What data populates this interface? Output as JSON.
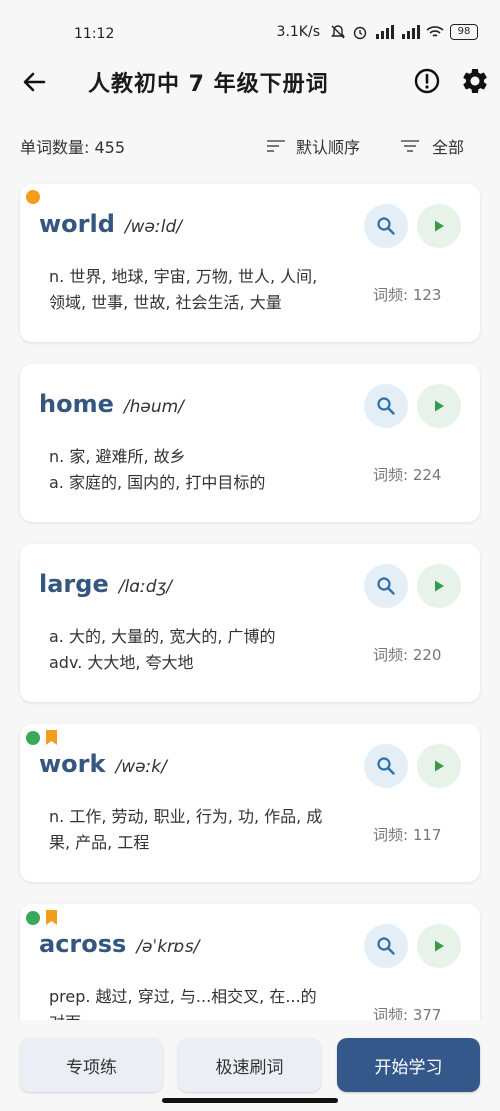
{
  "status_bar": {
    "time": "11:12",
    "network_speed": "3.1K/s",
    "battery": "98"
  },
  "header": {
    "title": "人教初中 7 年级下册词"
  },
  "filter": {
    "count_label": "单词数量: 455",
    "sort_label": "默认顺序",
    "scope_label": "全部"
  },
  "words": [
    {
      "word": "world",
      "phonetic": "/wəːld/",
      "meaning_lines": [
        "n. 世界, 地球, 宇宙, 万物, 世人, 人间,",
        "领域, 世事, 世故, 社会生活, 大量"
      ],
      "freq": "词频: 123",
      "dot_color": "#f39c1e",
      "bookmarked": false
    },
    {
      "word": "home",
      "phonetic": "/həum/",
      "meaning_lines": [
        "n. 家, 避难所, 故乡",
        "a. 家庭的, 国内的, 打中目标的"
      ],
      "freq": "词频: 224",
      "dot_color": "",
      "bookmarked": false
    },
    {
      "word": "large",
      "phonetic": "/lɑːdʒ/",
      "meaning_lines": [
        "a. 大的, 大量的, 宽大的, 广博的",
        "adv. 大大地, 夸大地"
      ],
      "freq": "词频: 220",
      "dot_color": "",
      "bookmarked": false
    },
    {
      "word": "work",
      "phonetic": "/wəːk/",
      "meaning_lines": [
        "n. 工作, 劳动, 职业, 行为, 功, 作品, 成",
        "果, 产品, 工程"
      ],
      "freq": "词频: 117",
      "dot_color": "#3aa85a",
      "bookmarked": true
    },
    {
      "word": "across",
      "phonetic": "/əˈkrɒs/",
      "meaning_lines": [
        "prep. 越过, 穿过, 与...相交叉, 在...的",
        "对面"
      ],
      "freq": "词频: 377",
      "dot_color": "#3aa85a",
      "bookmarked": true
    }
  ],
  "bottom": {
    "special_label": "专项练",
    "fast_label": "极速刷词",
    "start_label": "开始学习"
  },
  "colors": {
    "accent": "#34588a",
    "word": "#35577f",
    "bookmark": "#f39c1e"
  }
}
